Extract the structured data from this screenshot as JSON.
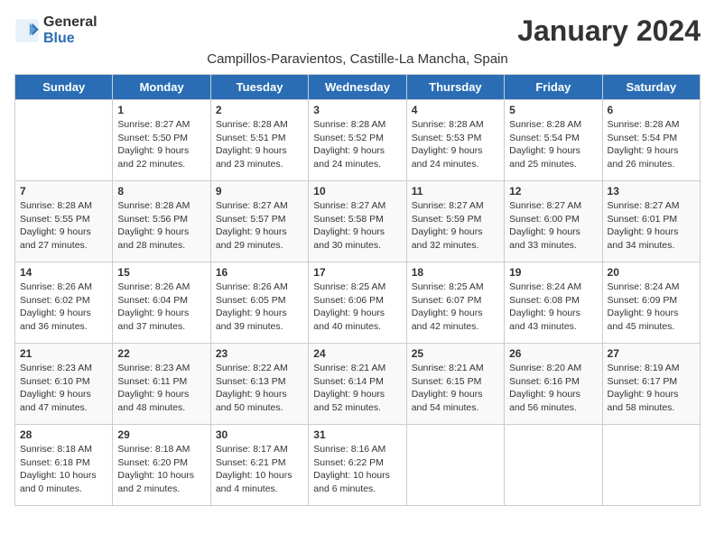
{
  "header": {
    "logo_line1": "General",
    "logo_line2": "Blue",
    "month_title": "January 2024",
    "location": "Campillos-Paravientos, Castille-La Mancha, Spain"
  },
  "weekdays": [
    "Sunday",
    "Monday",
    "Tuesday",
    "Wednesday",
    "Thursday",
    "Friday",
    "Saturday"
  ],
  "weeks": [
    [
      {
        "day": "",
        "text": ""
      },
      {
        "day": "1",
        "text": "Sunrise: 8:27 AM\nSunset: 5:50 PM\nDaylight: 9 hours\nand 22 minutes."
      },
      {
        "day": "2",
        "text": "Sunrise: 8:28 AM\nSunset: 5:51 PM\nDaylight: 9 hours\nand 23 minutes."
      },
      {
        "day": "3",
        "text": "Sunrise: 8:28 AM\nSunset: 5:52 PM\nDaylight: 9 hours\nand 24 minutes."
      },
      {
        "day": "4",
        "text": "Sunrise: 8:28 AM\nSunset: 5:53 PM\nDaylight: 9 hours\nand 24 minutes."
      },
      {
        "day": "5",
        "text": "Sunrise: 8:28 AM\nSunset: 5:54 PM\nDaylight: 9 hours\nand 25 minutes."
      },
      {
        "day": "6",
        "text": "Sunrise: 8:28 AM\nSunset: 5:54 PM\nDaylight: 9 hours\nand 26 minutes."
      }
    ],
    [
      {
        "day": "7",
        "text": "Sunrise: 8:28 AM\nSunset: 5:55 PM\nDaylight: 9 hours\nand 27 minutes."
      },
      {
        "day": "8",
        "text": "Sunrise: 8:28 AM\nSunset: 5:56 PM\nDaylight: 9 hours\nand 28 minutes."
      },
      {
        "day": "9",
        "text": "Sunrise: 8:27 AM\nSunset: 5:57 PM\nDaylight: 9 hours\nand 29 minutes."
      },
      {
        "day": "10",
        "text": "Sunrise: 8:27 AM\nSunset: 5:58 PM\nDaylight: 9 hours\nand 30 minutes."
      },
      {
        "day": "11",
        "text": "Sunrise: 8:27 AM\nSunset: 5:59 PM\nDaylight: 9 hours\nand 32 minutes."
      },
      {
        "day": "12",
        "text": "Sunrise: 8:27 AM\nSunset: 6:00 PM\nDaylight: 9 hours\nand 33 minutes."
      },
      {
        "day": "13",
        "text": "Sunrise: 8:27 AM\nSunset: 6:01 PM\nDaylight: 9 hours\nand 34 minutes."
      }
    ],
    [
      {
        "day": "14",
        "text": "Sunrise: 8:26 AM\nSunset: 6:02 PM\nDaylight: 9 hours\nand 36 minutes."
      },
      {
        "day": "15",
        "text": "Sunrise: 8:26 AM\nSunset: 6:04 PM\nDaylight: 9 hours\nand 37 minutes."
      },
      {
        "day": "16",
        "text": "Sunrise: 8:26 AM\nSunset: 6:05 PM\nDaylight: 9 hours\nand 39 minutes."
      },
      {
        "day": "17",
        "text": "Sunrise: 8:25 AM\nSunset: 6:06 PM\nDaylight: 9 hours\nand 40 minutes."
      },
      {
        "day": "18",
        "text": "Sunrise: 8:25 AM\nSunset: 6:07 PM\nDaylight: 9 hours\nand 42 minutes."
      },
      {
        "day": "19",
        "text": "Sunrise: 8:24 AM\nSunset: 6:08 PM\nDaylight: 9 hours\nand 43 minutes."
      },
      {
        "day": "20",
        "text": "Sunrise: 8:24 AM\nSunset: 6:09 PM\nDaylight: 9 hours\nand 45 minutes."
      }
    ],
    [
      {
        "day": "21",
        "text": "Sunrise: 8:23 AM\nSunset: 6:10 PM\nDaylight: 9 hours\nand 47 minutes."
      },
      {
        "day": "22",
        "text": "Sunrise: 8:23 AM\nSunset: 6:11 PM\nDaylight: 9 hours\nand 48 minutes."
      },
      {
        "day": "23",
        "text": "Sunrise: 8:22 AM\nSunset: 6:13 PM\nDaylight: 9 hours\nand 50 minutes."
      },
      {
        "day": "24",
        "text": "Sunrise: 8:21 AM\nSunset: 6:14 PM\nDaylight: 9 hours\nand 52 minutes."
      },
      {
        "day": "25",
        "text": "Sunrise: 8:21 AM\nSunset: 6:15 PM\nDaylight: 9 hours\nand 54 minutes."
      },
      {
        "day": "26",
        "text": "Sunrise: 8:20 AM\nSunset: 6:16 PM\nDaylight: 9 hours\nand 56 minutes."
      },
      {
        "day": "27",
        "text": "Sunrise: 8:19 AM\nSunset: 6:17 PM\nDaylight: 9 hours\nand 58 minutes."
      }
    ],
    [
      {
        "day": "28",
        "text": "Sunrise: 8:18 AM\nSunset: 6:18 PM\nDaylight: 10 hours\nand 0 minutes."
      },
      {
        "day": "29",
        "text": "Sunrise: 8:18 AM\nSunset: 6:20 PM\nDaylight: 10 hours\nand 2 minutes."
      },
      {
        "day": "30",
        "text": "Sunrise: 8:17 AM\nSunset: 6:21 PM\nDaylight: 10 hours\nand 4 minutes."
      },
      {
        "day": "31",
        "text": "Sunrise: 8:16 AM\nSunset: 6:22 PM\nDaylight: 10 hours\nand 6 minutes."
      },
      {
        "day": "",
        "text": ""
      },
      {
        "day": "",
        "text": ""
      },
      {
        "day": "",
        "text": ""
      }
    ]
  ]
}
